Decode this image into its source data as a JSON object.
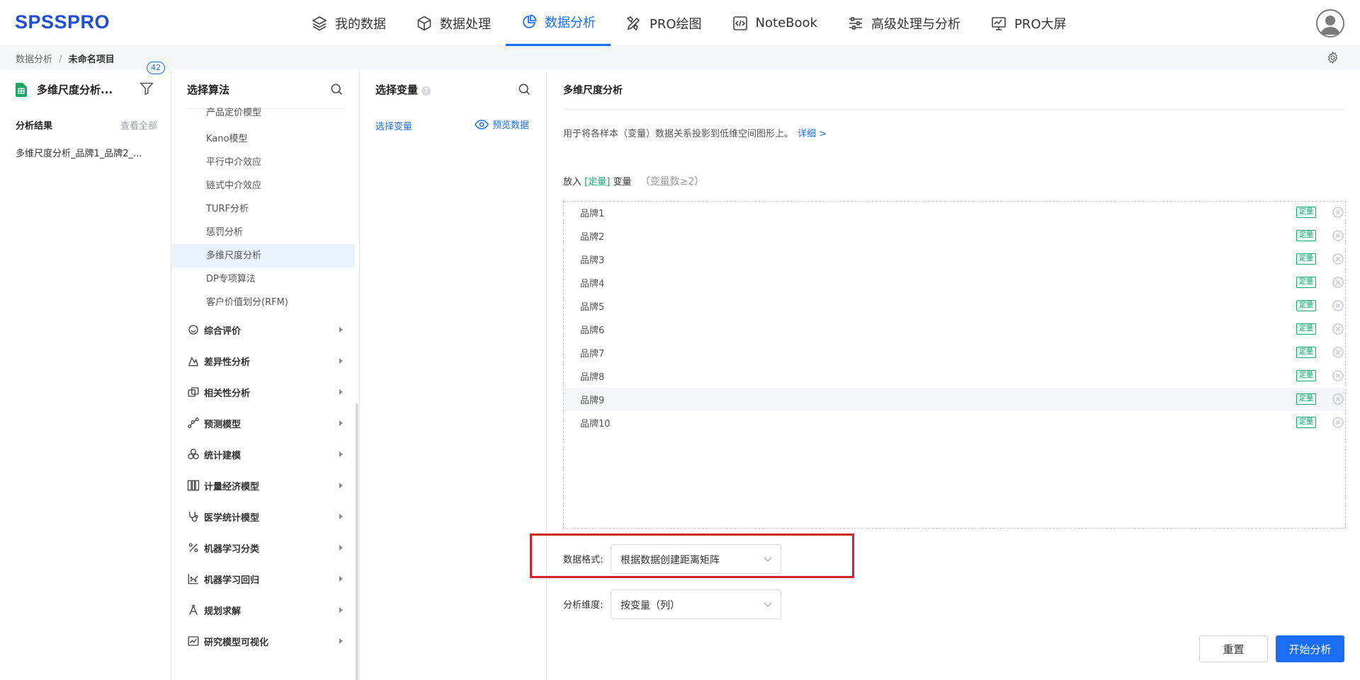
{
  "app": {
    "logo": "SPSSPRO"
  },
  "nav": {
    "items": [
      {
        "label": "我的数据",
        "icon": "layers-icon",
        "active": false
      },
      {
        "label": "数据处理",
        "icon": "cube-icon",
        "active": false
      },
      {
        "label": "数据分析",
        "icon": "pie-chart-icon",
        "active": true
      },
      {
        "label": "PRO绘图",
        "icon": "draw-tools-icon",
        "active": false
      },
      {
        "label": "NoteBook",
        "icon": "code-icon",
        "active": false
      },
      {
        "label": "高级处理与分析",
        "icon": "sliders-icon",
        "active": false
      },
      {
        "label": "PRO大屏",
        "icon": "monitor-icon",
        "active": false
      }
    ],
    "accent_color": "#1b6ef3"
  },
  "breadcrumb": {
    "root": "数据分析",
    "separator": "/",
    "current": "未命名项目"
  },
  "project": {
    "name": "多维尺度分析...",
    "filter_badge": "42",
    "results_title": "分析结果",
    "view_all": "查看全部",
    "result_item": "多维尺度分析_品牌1_品牌2_..."
  },
  "algorithms": {
    "title": "选择算法",
    "sub_items": [
      {
        "label": "产品定价模型",
        "active": false
      },
      {
        "label": "Kano模型",
        "active": false
      },
      {
        "label": "平行中介效应",
        "active": false
      },
      {
        "label": "链式中介效应",
        "active": false
      },
      {
        "label": "TURF分析",
        "active": false
      },
      {
        "label": "惩罚分析",
        "active": false
      },
      {
        "label": "多维尺度分析",
        "active": true
      },
      {
        "label": "DP专项算法",
        "active": false
      },
      {
        "label": "客户价值划分(RFM)",
        "active": false
      }
    ],
    "categories": [
      {
        "label": "综合评价",
        "icon": "chat-bubble-icon"
      },
      {
        "label": "差异性分析",
        "icon": "distribution-icon"
      },
      {
        "label": "相关性分析",
        "icon": "overlap-squares-icon"
      },
      {
        "label": "预测模型",
        "icon": "trend-nodes-icon"
      },
      {
        "label": "统计建模",
        "icon": "three-circles-icon"
      },
      {
        "label": "计量经济模型",
        "icon": "columns-icon"
      },
      {
        "label": "医学统计模型",
        "icon": "stethoscope-icon"
      },
      {
        "label": "机器学习分类",
        "icon": "percent-icon"
      },
      {
        "label": "机器学习回归",
        "icon": "scatter-line-icon"
      },
      {
        "label": "规划求解",
        "icon": "compass-icon"
      },
      {
        "label": "研究模型可视化",
        "icon": "line-chart-icon"
      }
    ]
  },
  "variables": {
    "title": "选择变量",
    "help": "?",
    "select_link": "选择变量",
    "preview_link": "预览数据"
  },
  "main": {
    "title": "多维尺度分析",
    "description": "用于将各样本（变量）数据关系投影到低维空间图形上。",
    "detail_link": "详细 >",
    "put_prefix": "放入",
    "put_tag": "[定量]",
    "put_suffix": "变量",
    "put_hint": "（变量数≥2）",
    "variables": [
      {
        "name": "品牌1",
        "tag": "定量"
      },
      {
        "name": "品牌2",
        "tag": "定量"
      },
      {
        "name": "品牌3",
        "tag": "定量"
      },
      {
        "name": "品牌4",
        "tag": "定量"
      },
      {
        "name": "品牌5",
        "tag": "定量"
      },
      {
        "name": "品牌6",
        "tag": "定量"
      },
      {
        "name": "品牌7",
        "tag": "定量"
      },
      {
        "name": "品牌8",
        "tag": "定量"
      },
      {
        "name": "品牌9",
        "tag": "定量"
      },
      {
        "name": "品牌10",
        "tag": "定量"
      }
    ],
    "data_format_label": "数据格式:",
    "data_format_value": "根据数据创建距离矩阵",
    "dimension_label": "分析维度:",
    "dimension_value": "按变量（列）",
    "reset_label": "重置",
    "start_label": "开始分析"
  }
}
